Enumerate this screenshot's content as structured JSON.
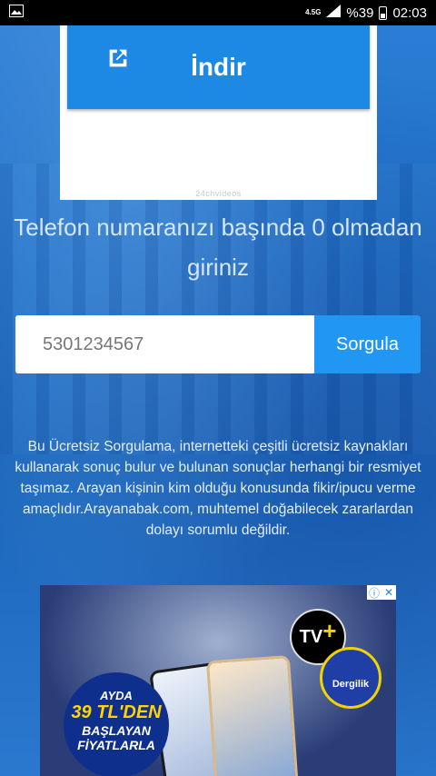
{
  "status_bar": {
    "network": "4.5G",
    "battery": "%39",
    "time": "02:03"
  },
  "card": {
    "download_label": "İndir",
    "watermark": "24chvideos"
  },
  "instruction": "Telefon numaranızı başında 0 olmadan giriniz",
  "search": {
    "value": "5301234567",
    "button_label": "Sorgula"
  },
  "disclaimer": "Bu Ücretsiz Sorgulama, internetteki çeşitli ücretsiz kaynakları kullanarak sonuç bulur ve bulunan sonuçlar herhangi bir resmiyet taşımaz. Arayan kişinin kim olduğu konusunda fikir/ipucu verme amaçlıdır.Arayanabak.com, muhtemel doğabilecek zararlardan dolayı sorumlu değildir.",
  "ad": {
    "logo_text": "TV",
    "logo_plus": "+",
    "badge_text": "Dergilik",
    "promo_line1": "AYDA",
    "promo_line2": "39 TL'DEN",
    "promo_line3": "BAŞLAYAN FİYATLARLA",
    "info_icon": "ⓘ",
    "close_icon": "✕"
  }
}
